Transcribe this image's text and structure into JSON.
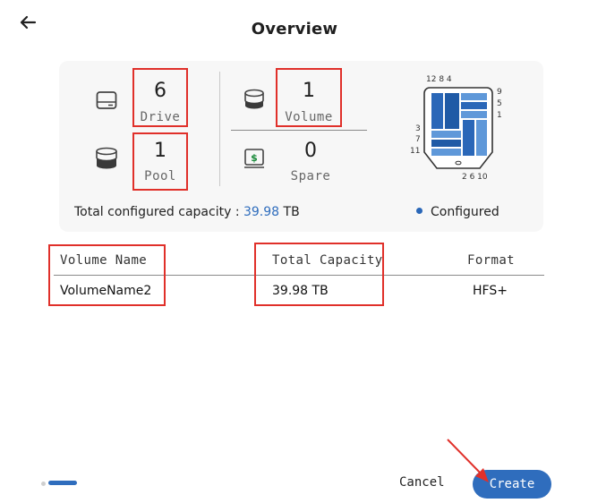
{
  "header": {
    "title": "Overview",
    "back_icon": "arrow-left-icon"
  },
  "summary": {
    "drive": {
      "count": "6",
      "label": "Drive",
      "icon": "hard-drive-icon"
    },
    "volume": {
      "count": "1",
      "label": "Volume",
      "icon": "volume-stack-icon"
    },
    "pool": {
      "count": "1",
      "label": "Pool",
      "icon": "pool-cylinder-icon"
    },
    "spare": {
      "count": "0",
      "label": "Spare",
      "icon": "spare-drive-icon"
    },
    "capacity_label": "Total configured capacity : ",
    "capacity_value": "39.98",
    "capacity_unit": " TB",
    "legend_label": "Configured",
    "legend_color": "#2a67b8",
    "diagram": {
      "top_numbers": "12 8 4",
      "right_numbers": [
        "9",
        "5",
        "1"
      ],
      "left_numbers": [
        "3",
        "7",
        "11"
      ],
      "bottom_numbers": "2 6 10"
    }
  },
  "table": {
    "columns": [
      "Volume Name",
      "Total Capacity",
      "Format"
    ],
    "rows": [
      [
        "VolumeName2",
        "39.98 TB",
        "HFS+"
      ]
    ]
  },
  "footer": {
    "cancel_label": "Cancel",
    "create_label": "Create",
    "pager": {
      "pages": 2,
      "current": 1
    }
  },
  "colors": {
    "accent": "#2f6dbd",
    "annotation": "#e0302a"
  }
}
